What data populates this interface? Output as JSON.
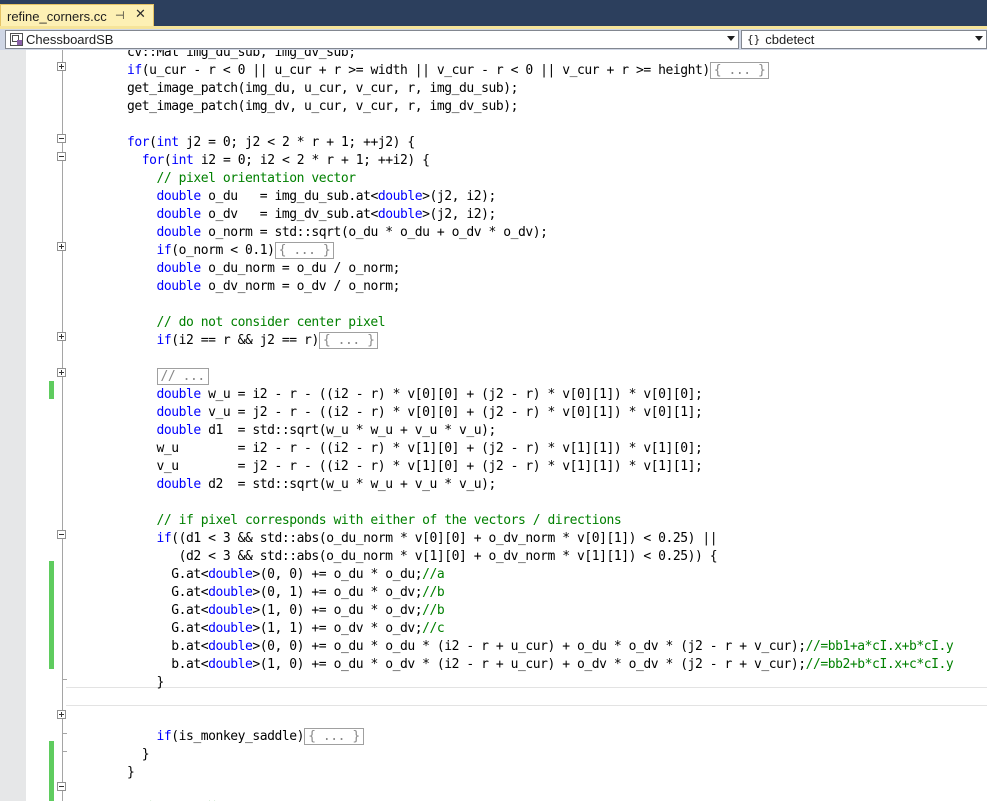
{
  "editor_tab": {
    "title": "refine_corners.cc",
    "pin_glyph": "⊣",
    "close_glyph": "✕"
  },
  "navigation": {
    "scope_dropdown": {
      "selected": "ChessboardSB",
      "icon": "class-icon"
    },
    "member_dropdown": {
      "selected": "cbdetect",
      "icon": "namespace-braces-icon"
    }
  },
  "colors": {
    "keyword": "#0000ff",
    "comment": "#008000",
    "macro": "#808080",
    "change_bar": "#5fcc5f",
    "tab_active": "#fdf0b4",
    "tab_strip": "#2c3f5d"
  },
  "code_lines": [
    [
      [
        "p",
        "cv::Mat img_du_sub, img_dv_sub;"
      ]
    ],
    [
      [
        "k",
        "if"
      ],
      [
        "p",
        "(u_cur - r < 0 || u_cur + r >= width || v_cur - r < 0 || v_cur + r >= height)"
      ],
      [
        "b",
        "{ ... }"
      ]
    ],
    [
      [
        "p",
        "get_image_patch(img_du, u_cur, v_cur, r, img_du_sub);"
      ]
    ],
    [
      [
        "p",
        "get_image_patch(img_dv, u_cur, v_cur, r, img_dv_sub);"
      ]
    ],
    [],
    [
      [
        "k",
        "for"
      ],
      [
        "p",
        "("
      ],
      [
        "k",
        "int"
      ],
      [
        "p",
        " j2 = 0; j2 < 2 * r + 1; ++j2) {"
      ]
    ],
    [
      [
        "p",
        "  "
      ],
      [
        "k",
        "for"
      ],
      [
        "p",
        "("
      ],
      [
        "k",
        "int"
      ],
      [
        "p",
        " i2 = 0; i2 < 2 * r + 1; ++i2) {"
      ]
    ],
    [
      [
        "c",
        "    // pixel orientation vector"
      ]
    ],
    [
      [
        "p",
        "    "
      ],
      [
        "k",
        "double"
      ],
      [
        "p",
        " o_du   = img_du_sub.at<"
      ],
      [
        "k",
        "double"
      ],
      [
        "p",
        ">(j2, i2);"
      ]
    ],
    [
      [
        "p",
        "    "
      ],
      [
        "k",
        "double"
      ],
      [
        "p",
        " o_dv   = img_dv_sub.at<"
      ],
      [
        "k",
        "double"
      ],
      [
        "p",
        ">(j2, i2);"
      ]
    ],
    [
      [
        "p",
        "    "
      ],
      [
        "k",
        "double"
      ],
      [
        "p",
        " o_norm = std::sqrt(o_du * o_du + o_dv * o_dv);"
      ]
    ],
    [
      [
        "p",
        "    "
      ],
      [
        "k",
        "if"
      ],
      [
        "p",
        "(o_norm < 0.1)"
      ],
      [
        "b",
        "{ ... }"
      ]
    ],
    [
      [
        "p",
        "    "
      ],
      [
        "k",
        "double"
      ],
      [
        "p",
        " o_du_norm = o_du / o_norm;"
      ]
    ],
    [
      [
        "p",
        "    "
      ],
      [
        "k",
        "double"
      ],
      [
        "p",
        " o_dv_norm = o_dv / o_norm;"
      ]
    ],
    [],
    [
      [
        "c",
        "    // do not consider center pixel"
      ]
    ],
    [
      [
        "p",
        "    "
      ],
      [
        "k",
        "if"
      ],
      [
        "p",
        "(i2 == r && j2 == r)"
      ],
      [
        "b",
        "{ ... }"
      ]
    ],
    [],
    [
      [
        "p",
        "    "
      ],
      [
        "b",
        "// ..."
      ]
    ],
    [
      [
        "p",
        "    "
      ],
      [
        "k",
        "double"
      ],
      [
        "p",
        " w_u = i2 - r - ((i2 - r) * v[0][0] + (j2 - r) * v[0][1]) * v[0][0];"
      ]
    ],
    [
      [
        "p",
        "    "
      ],
      [
        "k",
        "double"
      ],
      [
        "p",
        " v_u = j2 - r - ((i2 - r) * v[0][0] + (j2 - r) * v[0][1]) * v[0][1];"
      ]
    ],
    [
      [
        "p",
        "    "
      ],
      [
        "k",
        "double"
      ],
      [
        "p",
        " d1  = std::sqrt(w_u * w_u + v_u * v_u);"
      ]
    ],
    [
      [
        "p",
        "    w_u        = i2 - r - ((i2 - r) * v[1][0] + (j2 - r) * v[1][1]) * v[1][0];"
      ]
    ],
    [
      [
        "p",
        "    v_u        = j2 - r - ((i2 - r) * v[1][0] + (j2 - r) * v[1][1]) * v[1][1];"
      ]
    ],
    [
      [
        "p",
        "    "
      ],
      [
        "k",
        "double"
      ],
      [
        "p",
        " d2  = std::sqrt(w_u * w_u + v_u * v_u);"
      ]
    ],
    [],
    [
      [
        "c",
        "    // if pixel corresponds with either of the vectors / directions"
      ]
    ],
    [
      [
        "p",
        "    "
      ],
      [
        "k",
        "if"
      ],
      [
        "p",
        "((d1 < 3 && std::abs(o_du_norm * v[0][0] + o_dv_norm * v[0][1]) < 0.25) ||"
      ]
    ],
    [
      [
        "p",
        "       (d2 < 3 && std::abs(o_du_norm * v[1][0] + o_dv_norm * v[1][1]) < 0.25)) {"
      ]
    ],
    [
      [
        "p",
        "      G.at<"
      ],
      [
        "k",
        "double"
      ],
      [
        "p",
        ">(0, 0) += o_du * o_du;"
      ],
      [
        "c",
        "//a"
      ]
    ],
    [
      [
        "p",
        "      G.at<"
      ],
      [
        "k",
        "double"
      ],
      [
        "p",
        ">(0, 1) += o_du * o_dv;"
      ],
      [
        "c",
        "//b"
      ]
    ],
    [
      [
        "p",
        "      G.at<"
      ],
      [
        "k",
        "double"
      ],
      [
        "p",
        ">(1, 0) += o_du * o_dv;"
      ],
      [
        "c",
        "//b"
      ]
    ],
    [
      [
        "p",
        "      G.at<"
      ],
      [
        "k",
        "double"
      ],
      [
        "p",
        ">(1, 1) += o_dv * o_dv;"
      ],
      [
        "c",
        "//c"
      ]
    ],
    [
      [
        "p",
        "      b.at<"
      ],
      [
        "k",
        "double"
      ],
      [
        "p",
        ">(0, 0) += o_du * o_du * (i2 - r + u_cur) + o_du * o_dv * (j2 - r + v_cur);"
      ],
      [
        "c",
        "//=bb1+a*cI.x+b*cI.y"
      ]
    ],
    [
      [
        "p",
        "      b.at<"
      ],
      [
        "k",
        "double"
      ],
      [
        "p",
        ">(1, 0) += o_du * o_dv * (i2 - r + u_cur) + o_dv * o_dv * (j2 - r + v_cur);"
      ],
      [
        "c",
        "//=bb2+b*cI.x+c*cI.y"
      ]
    ],
    [
      [
        "p",
        "    }"
      ]
    ],
    [],
    [],
    [
      [
        "p",
        "    "
      ],
      [
        "k",
        "if"
      ],
      [
        "p",
        "(is_monkey_saddle)"
      ],
      [
        "b",
        "{ ... }"
      ]
    ],
    [
      [
        "p",
        "  }"
      ]
    ],
    [
      [
        "p",
        "}"
      ]
    ],
    [],
    [
      [
        "c",
        "//验证cI是否等于new_pos"
      ]
    ]
  ]
}
